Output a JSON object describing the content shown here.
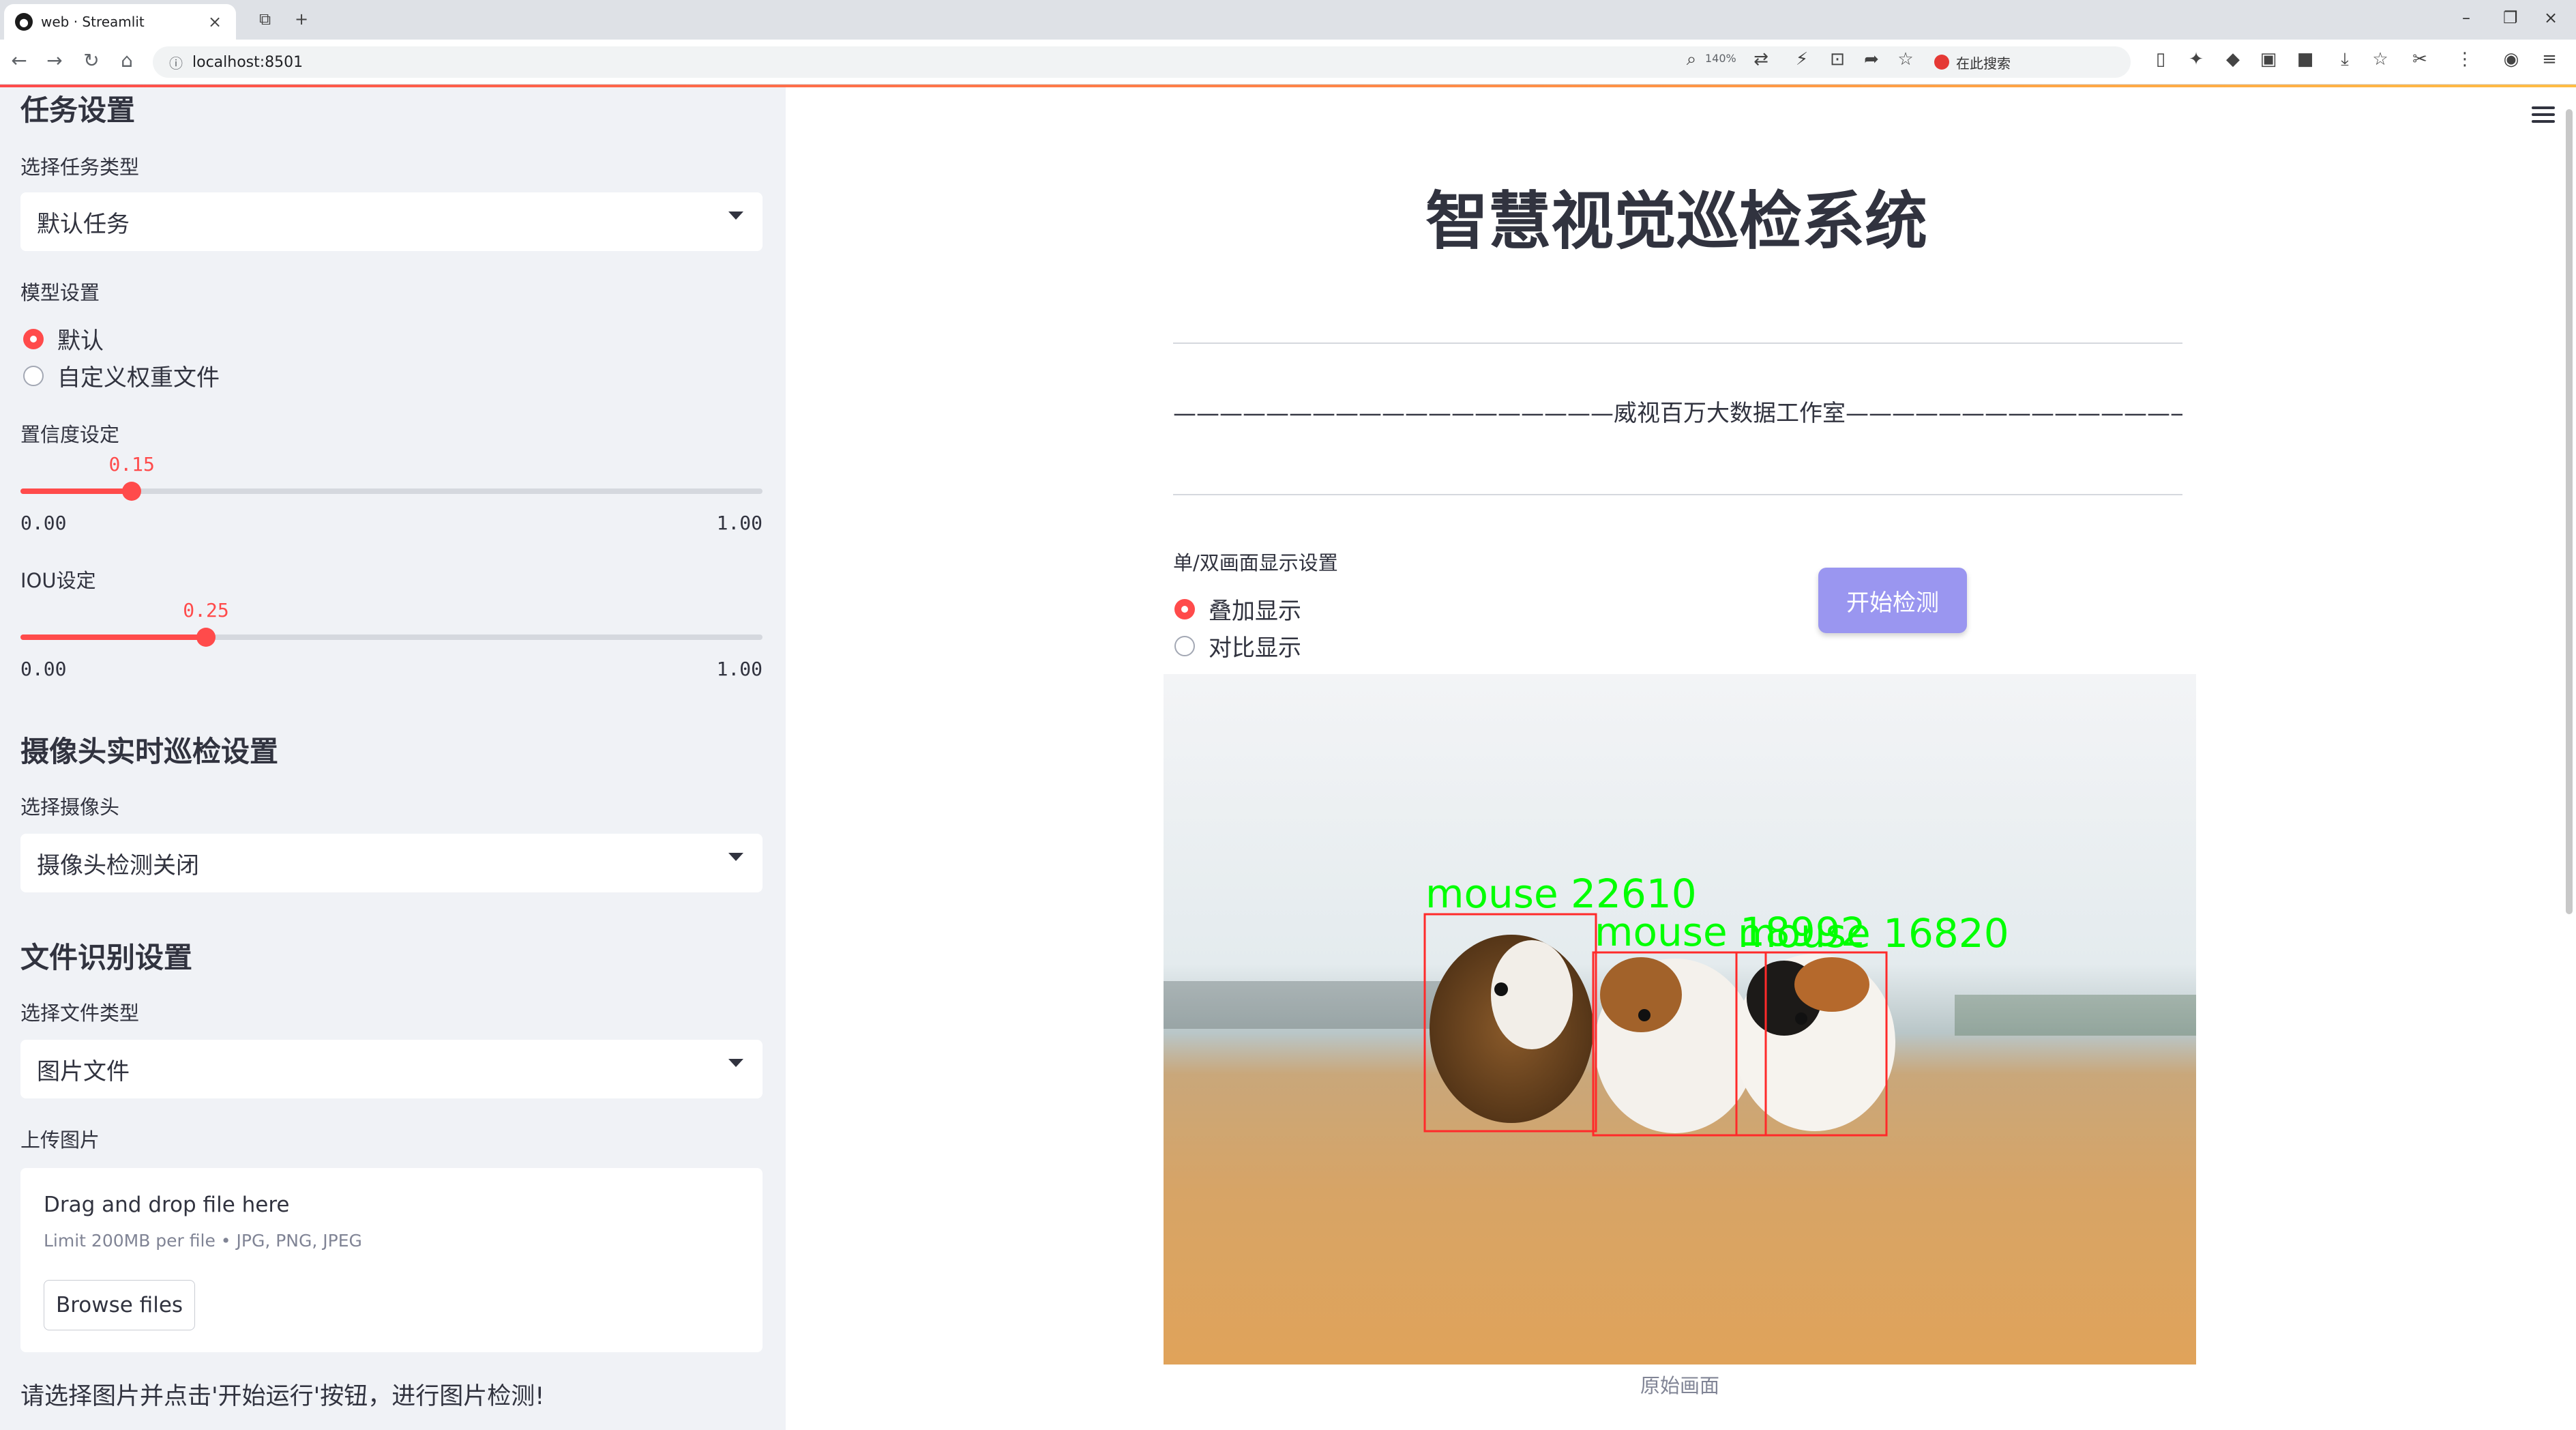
{
  "browser": {
    "tab_title": "web · Streamlit",
    "url": "localhost:8501",
    "zoom": "140%",
    "search_label": "在此搜索"
  },
  "sidebar": {
    "task_section": {
      "heading": "任务设置",
      "task_type_label": "选择任务类型",
      "task_type_value": "默认任务"
    },
    "model_section": {
      "label": "模型设置",
      "options": [
        "默认",
        "自定义权重文件"
      ],
      "selected": 0
    },
    "confidence": {
      "label": "置信度设定",
      "value": 0.15,
      "value_text": "0.15",
      "min_text": "0.00",
      "max_text": "1.00"
    },
    "iou": {
      "label": "IOU设定",
      "value": 0.25,
      "value_text": "0.25",
      "min_text": "0.00",
      "max_text": "1.00"
    },
    "camera_section": {
      "heading": "摄像头实时巡检设置",
      "camera_label": "选择摄像头",
      "camera_value": "摄像头检测关闭"
    },
    "file_section": {
      "heading": "文件识别设置",
      "file_type_label": "选择文件类型",
      "file_type_value": "图片文件",
      "upload_label": "上传图片",
      "drop_text": "Drag and drop file here",
      "limit_text": "Limit 200MB per file • JPG, PNG, JPEG",
      "browse_label": "Browse files"
    },
    "hint": "请选择图片并点击'开始运行'按钮，进行图片检测!"
  },
  "main": {
    "title": "智慧视觉巡检系统",
    "subtitle": "———————————————————威视百万大数据工作室————————————————————",
    "display_label": "单/双画面显示设置",
    "display_options": [
      "叠加显示",
      "对比显示"
    ],
    "display_selected": 0,
    "start_button": "开始检测",
    "caption": "原始画面",
    "detections": [
      {
        "label": "mouse  22610"
      },
      {
        "label": "mouse  18992"
      },
      {
        "label": "mouse  16820"
      }
    ]
  },
  "colors": {
    "accent": "#ff4b4b",
    "sidebar_bg": "#f0f2f6",
    "button_bg": "#9a96f0",
    "box_color": "#ff2a2a",
    "label_color": "#00ff00"
  }
}
